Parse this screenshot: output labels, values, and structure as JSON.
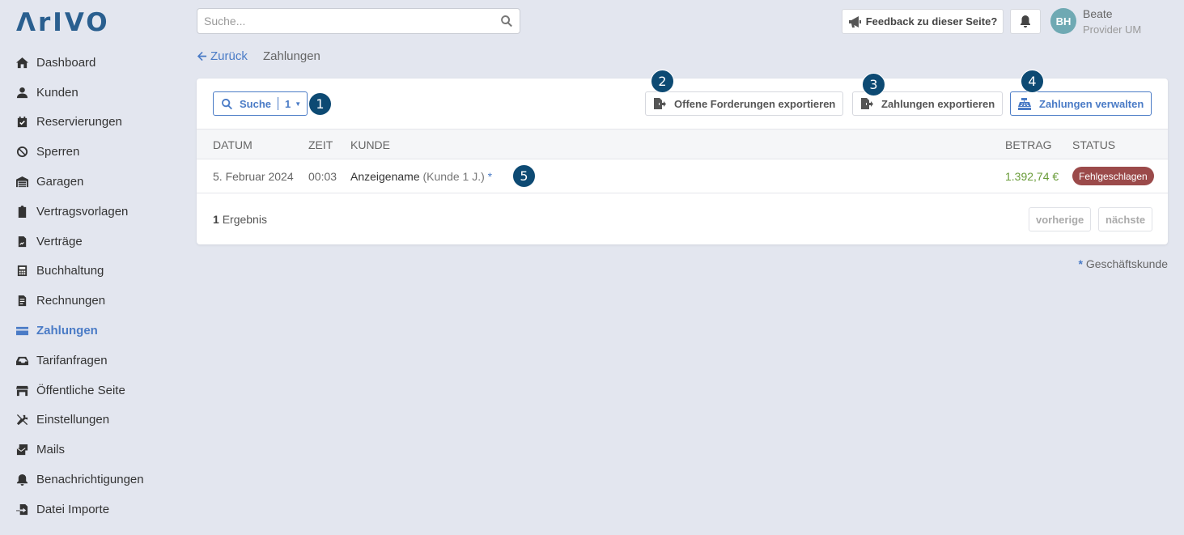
{
  "app": {
    "logo": "ΛrIVO"
  },
  "sidebar": {
    "items": [
      {
        "label": "Dashboard",
        "icon": "home-icon"
      },
      {
        "label": "Kunden",
        "icon": "user-icon"
      },
      {
        "label": "Reservierungen",
        "icon": "calendar-check-icon"
      },
      {
        "label": "Sperren",
        "icon": "ban-icon"
      },
      {
        "label": "Garagen",
        "icon": "warehouse-icon"
      },
      {
        "label": "Vertragsvorlagen",
        "icon": "clipboard-icon"
      },
      {
        "label": "Verträge",
        "icon": "file-contract-icon"
      },
      {
        "label": "Buchhaltung",
        "icon": "calculator-icon"
      },
      {
        "label": "Rechnungen",
        "icon": "invoice-icon"
      },
      {
        "label": "Zahlungen",
        "icon": "credit-card-icon",
        "active": true
      },
      {
        "label": "Tarifanfragen",
        "icon": "inbox-icon"
      },
      {
        "label": "Öffentliche Seite",
        "icon": "store-icon"
      },
      {
        "label": "Einstellungen",
        "icon": "tools-icon"
      },
      {
        "label": "Mails",
        "icon": "mail-bulk-icon"
      },
      {
        "label": "Benachrichtigungen",
        "icon": "bell-icon"
      },
      {
        "label": "Datei Importe",
        "icon": "file-import-icon"
      }
    ]
  },
  "header": {
    "search_placeholder": "Suche...",
    "feedback_label": "Feedback zu dieser Seite?",
    "user": {
      "initials": "BH",
      "name": "Beate",
      "role": "Provider UM"
    }
  },
  "breadcrumb": {
    "back_label": "Zurück",
    "current": "Zahlungen"
  },
  "toolbar": {
    "filter_label": "Suche",
    "filter_count": "1",
    "export_open_label": "Offene Forderungen exportieren",
    "export_payments_label": "Zahlungen exportieren",
    "manage_payments_label": "Zahlungen verwalten"
  },
  "table": {
    "columns": {
      "date": "DATUM",
      "time": "ZEIT",
      "customer": "KUNDE",
      "amount": "BETRAG",
      "status": "STATUS"
    },
    "rows": [
      {
        "date": "5. Februar 2024",
        "time": "00:03",
        "customer": "Anzeigename",
        "customer_sub": "(Kunde 1 J.)",
        "business_marker": "*",
        "amount": "1.392,74 €",
        "status": "Fehlgeschlagen"
      }
    ]
  },
  "footer": {
    "result_count": "1",
    "result_label": "Ergebnis",
    "prev_label": "vorherige",
    "next_label": "nächste"
  },
  "footnote": {
    "marker": "*",
    "label": "Geschäftskunde"
  },
  "markers": [
    "1",
    "2",
    "3",
    "4",
    "5"
  ],
  "colors": {
    "accent": "#4a7bc6",
    "marker": "#0d4a73",
    "status_failed": "#9b4a4a",
    "amount": "#6a9c3a"
  }
}
